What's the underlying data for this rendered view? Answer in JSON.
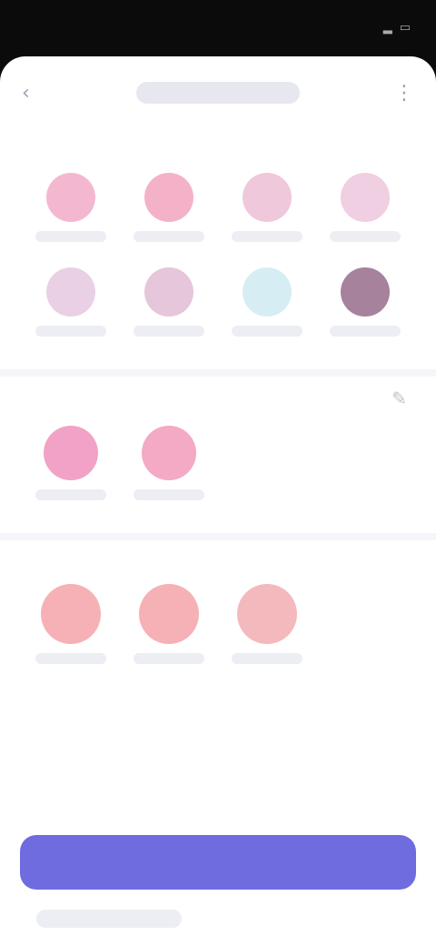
{
  "header": {
    "title": ""
  },
  "sections": [
    {
      "title": ""
    },
    {
      "title": ""
    },
    {
      "title": ""
    }
  ],
  "section1": {
    "items": [
      {
        "label": "",
        "color": "#f3b8cf"
      },
      {
        "label": "",
        "color": "#f3b2c8"
      },
      {
        "label": "",
        "color": "#efc8dc"
      },
      {
        "label": "",
        "color": "#efcfe1"
      },
      {
        "label": "",
        "color": "#ead0e4"
      },
      {
        "label": "",
        "color": "#e5c6da"
      },
      {
        "label": "",
        "color": "#d6edf4"
      },
      {
        "label": "",
        "color": "#a7829c"
      }
    ]
  },
  "section2": {
    "items": [
      {
        "label": "",
        "color": "#f2a2c6"
      },
      {
        "label": "",
        "color": "#f4a9c4"
      }
    ]
  },
  "section3": {
    "items": [
      {
        "label": "",
        "color": "#f6b1b6"
      },
      {
        "label": "",
        "color": "#f6b1b6"
      },
      {
        "label": "",
        "color": "#f3b9bd"
      }
    ]
  },
  "cta": {
    "label": ""
  },
  "footer": {
    "title": ""
  },
  "colors": {
    "accent": "#6f6ce0",
    "sheet_bg": "#ffffff",
    "screen_bg": "#0b0b0b"
  }
}
